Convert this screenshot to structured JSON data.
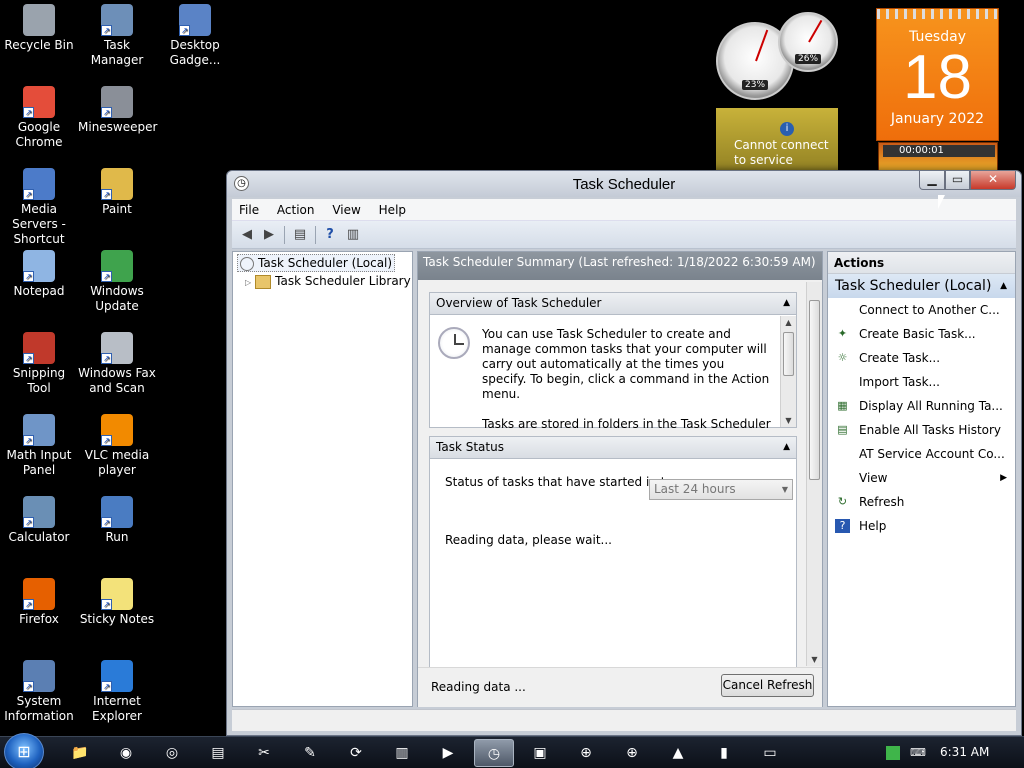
{
  "desktop": {
    "icons": [
      {
        "label": "Recycle Bin",
        "icon": "recycle-bin-icon",
        "color": "#9aa3ad"
      },
      {
        "label": "Task Manager",
        "icon": "task-manager-icon",
        "color": "#6d8fb8"
      },
      {
        "label": "Desktop Gadge...",
        "icon": "desktop-gadgets-icon",
        "color": "#5a83c6"
      },
      {
        "label": "Google Chrome",
        "icon": "chrome-icon",
        "color": "#e44d3a"
      },
      {
        "label": "Minesweeper",
        "icon": "minesweeper-icon",
        "color": "#8a8f98"
      },
      {
        "label": "Media Servers - Shortcut",
        "icon": "media-servers-icon",
        "color": "#4c7bc9"
      },
      {
        "label": "Paint",
        "icon": "paint-icon",
        "color": "#e0b94a"
      },
      {
        "label": "Notepad",
        "icon": "notepad-icon",
        "color": "#8fb5e3"
      },
      {
        "label": "Windows Update",
        "icon": "windows-update-icon",
        "color": "#3fa34d"
      },
      {
        "label": "Snipping Tool",
        "icon": "snipping-tool-icon",
        "color": "#c0392b"
      },
      {
        "label": "Windows Fax and Scan",
        "icon": "fax-scan-icon",
        "color": "#b8bec6"
      },
      {
        "label": "Math Input Panel",
        "icon": "math-input-icon",
        "color": "#6f95c7"
      },
      {
        "label": "VLC media player",
        "icon": "vlc-icon",
        "color": "#f28a00"
      },
      {
        "label": "Calculator",
        "icon": "calculator-icon",
        "color": "#6a8fb5"
      },
      {
        "label": "Run",
        "icon": "run-icon",
        "color": "#4a7cc2"
      },
      {
        "label": "Firefox",
        "icon": "firefox-icon",
        "color": "#e66000"
      },
      {
        "label": "Sticky Notes",
        "icon": "sticky-notes-icon",
        "color": "#f3e27a"
      },
      {
        "label": "System Information",
        "icon": "system-info-icon",
        "color": "#5b7fb3"
      },
      {
        "label": "Internet Explorer",
        "icon": "ie-icon",
        "color": "#2a7bd8"
      }
    ]
  },
  "gadgets": {
    "cpu_pct": "23%",
    "mem_pct": "26%",
    "weather_line1": "Cannot connect",
    "weather_line2": "to service",
    "cal_day": "Tuesday",
    "cal_date": "18",
    "cal_month": "January 2022",
    "timer": "00:00:01"
  },
  "window": {
    "title": "Task Scheduler",
    "menu": [
      "File",
      "Action",
      "View",
      "Help"
    ],
    "tree": {
      "root": "Task Scheduler (Local)",
      "child": "Task Scheduler Library"
    },
    "center": {
      "header": "Task Scheduler Summary (Last refreshed: 1/18/2022 6:30:59 AM)",
      "overview_title": "Overview of Task Scheduler",
      "overview_p1": "You can use Task Scheduler to create and manage common tasks that your computer will carry out automatically at the times you specify. To begin, click a command in the Action menu.",
      "overview_p2": "Tasks are stored in folders in the Task Scheduler Library. To view or perform an operation on an",
      "status_title": "Task Status",
      "status_label": "Status of tasks that have started in t...",
      "status_range": "Last 24 hours",
      "reading": "Reading data, please wait...",
      "footer_status": "Reading data ...",
      "cancel_label": "Cancel Refresh"
    },
    "actions": {
      "header": "Actions",
      "group": "Task Scheduler (Local)",
      "items": [
        {
          "label": "Connect to Another C...",
          "icon": ""
        },
        {
          "label": "Create Basic Task...",
          "icon": "wizard-icon"
        },
        {
          "label": "Create Task...",
          "icon": "create-task-icon"
        },
        {
          "label": "Import Task...",
          "icon": ""
        },
        {
          "label": "Display All Running Ta...",
          "icon": "running-tasks-icon"
        },
        {
          "label": "Enable All Tasks History",
          "icon": "history-icon"
        },
        {
          "label": "AT Service Account Co...",
          "icon": ""
        },
        {
          "label": "View",
          "icon": "",
          "submenu": true
        },
        {
          "label": "Refresh",
          "icon": "refresh-icon"
        },
        {
          "label": "Help",
          "icon": "help-icon"
        }
      ]
    }
  },
  "taskbar": {
    "time": "6:31 AM",
    "buttons": [
      "explorer-icon",
      "firefox-icon",
      "chrome-icon",
      "notepad-icon",
      "snipping-tool-icon",
      "paint-icon",
      "windows-update-icon",
      "fax-scan-icon",
      "run-icon",
      "task-scheduler-icon",
      "media-servers-icon",
      "network-icon",
      "network-icon",
      "vlc-icon",
      "cmd-icon",
      "remote-icon"
    ]
  }
}
